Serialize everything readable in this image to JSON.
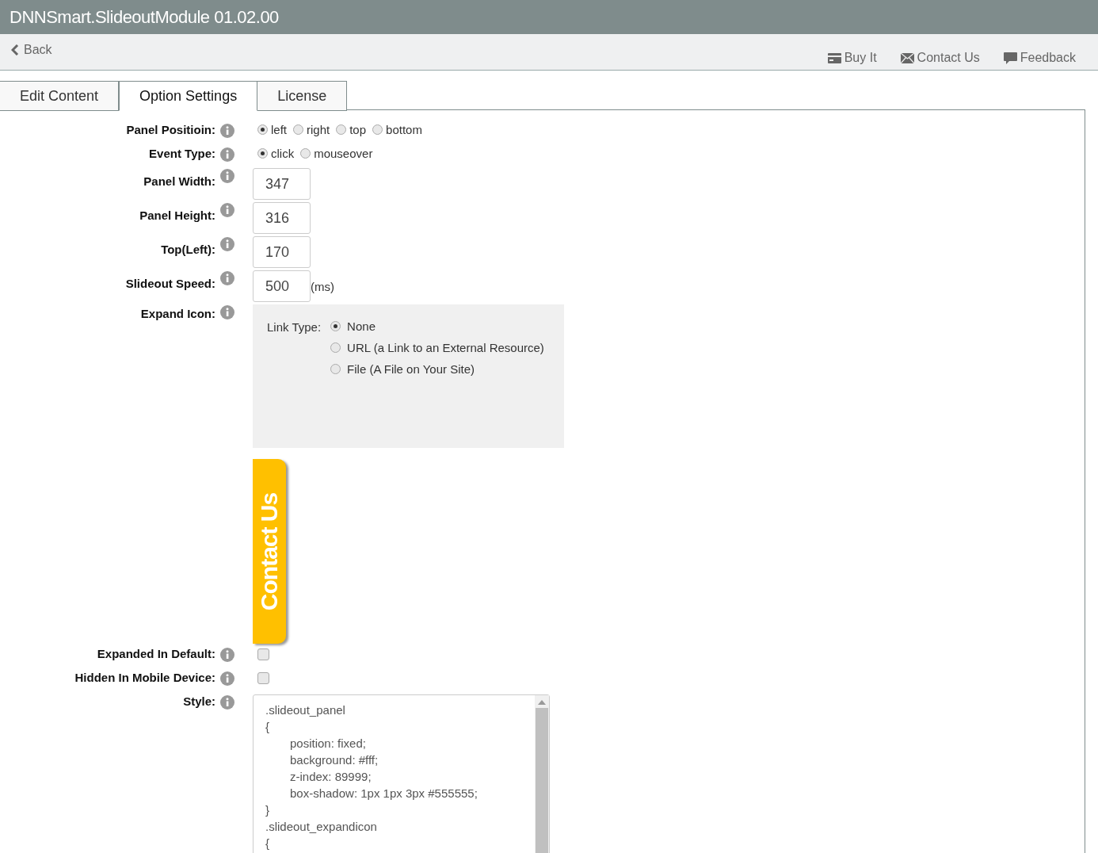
{
  "window": {
    "title": "DNNSmart.SlideoutModule 01.02.00"
  },
  "nav": {
    "back": "Back",
    "links": [
      {
        "kind": "card",
        "label": "Buy It"
      },
      {
        "kind": "mail",
        "label": "Contact Us"
      },
      {
        "kind": "chat",
        "label": "Feedback"
      }
    ]
  },
  "tabs": [
    {
      "label": "Edit Content",
      "selected": false
    },
    {
      "label": "Option Settings",
      "selected": true
    },
    {
      "label": "License",
      "selected": false
    }
  ],
  "form": {
    "panel_position": {
      "label": "Panel Positioin:",
      "options": [
        {
          "label": "left",
          "selected": true
        },
        {
          "label": "right",
          "selected": false
        },
        {
          "label": "top",
          "selected": false
        },
        {
          "label": "bottom",
          "selected": false
        }
      ]
    },
    "event_type": {
      "label": "Event Type:",
      "options": [
        {
          "label": "click",
          "selected": true
        },
        {
          "label": "mouseover",
          "selected": false
        }
      ]
    },
    "number_fields": [
      {
        "label": "Panel Width:",
        "value": "347"
      },
      {
        "label": "Panel Height:",
        "value": "316"
      },
      {
        "label": "Top(Left):",
        "value": "170"
      },
      {
        "label": "Slideout Speed:",
        "value": "500",
        "unit": "(ms)"
      }
    ],
    "expand_icon": {
      "label": "Expand Icon:",
      "link_type_label": "Link Type:",
      "options": [
        {
          "label": "None",
          "selected": true
        },
        {
          "label": "URL (a Link to an External Resource)",
          "selected": false
        },
        {
          "label": "File (A File on Your Site)",
          "selected": false
        }
      ],
      "tab_text": "Contact Us"
    },
    "checkboxes": [
      {
        "label": "Expanded In Default:",
        "checked": false
      },
      {
        "label": "Hidden In Mobile Device:",
        "checked": false
      }
    ],
    "style": {
      "label": "Style:",
      "lines": [
        {
          "text": ".slideout_panel",
          "indented": false
        },
        {
          "text": "{",
          "indented": false
        },
        {
          "text": "position: fixed;",
          "indented": true
        },
        {
          "text": "background: #fff;",
          "indented": true
        },
        {
          "text": "z-index: 89999;",
          "indented": true
        },
        {
          "text": "box-shadow: 1px 1px 3px #555555;",
          "indented": true
        },
        {
          "text": "}",
          "indented": false
        },
        {
          "text": ".slideout_expandicon",
          "indented": false
        },
        {
          "text": "{",
          "indented": false
        }
      ]
    }
  }
}
